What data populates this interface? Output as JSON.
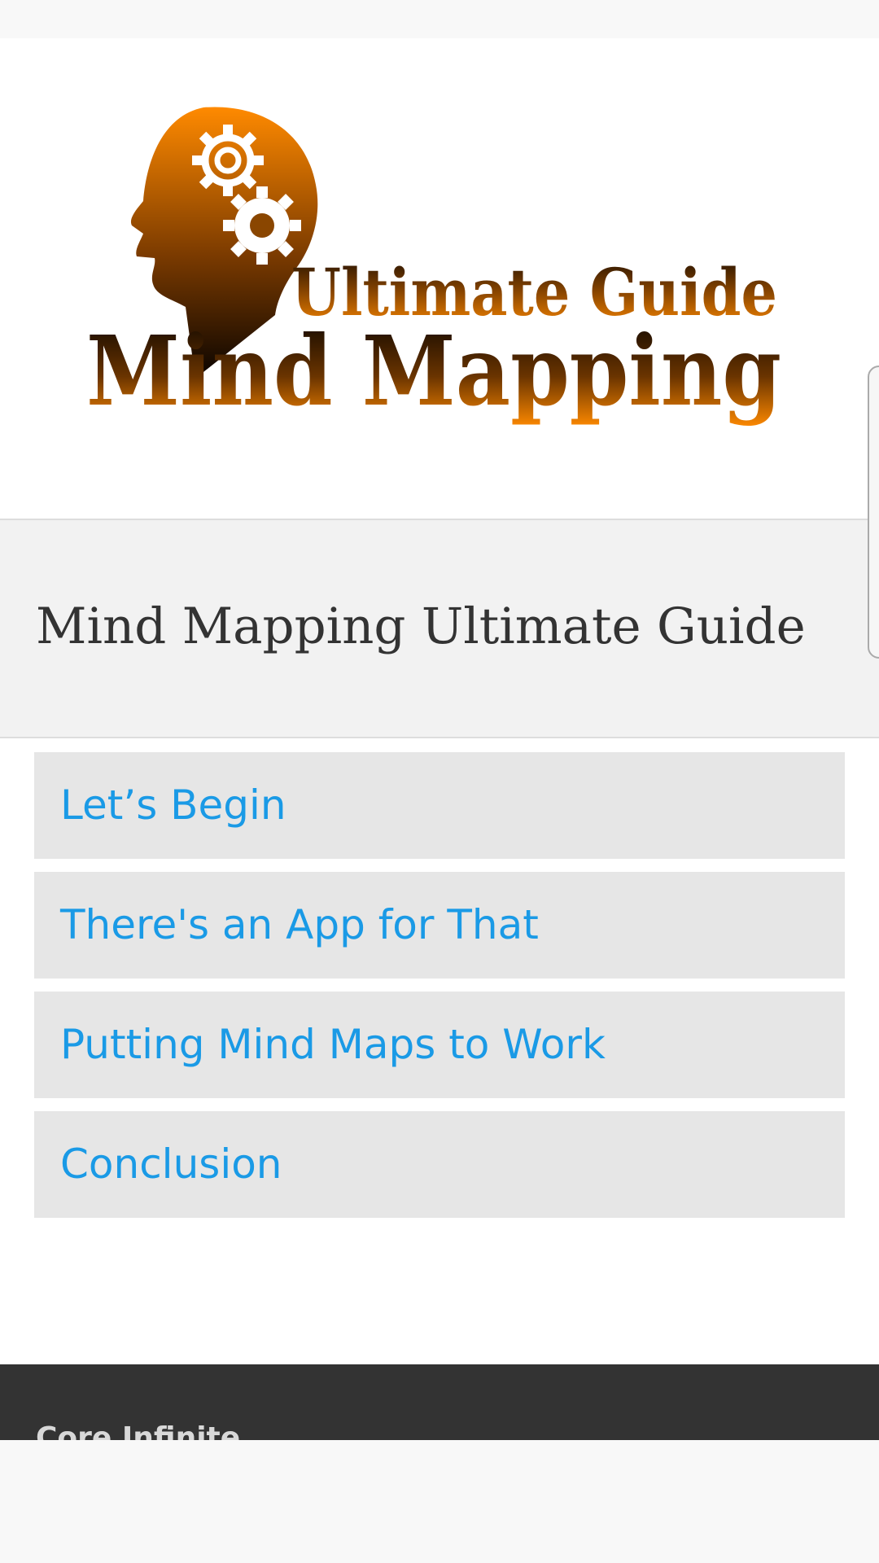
{
  "logo": {
    "line1": "Ultimate Guide",
    "line2": "Mind Mapping",
    "icon": "head-with-gears-icon",
    "colors": {
      "orange": "#ff8a00",
      "dark": "#1a0c00"
    }
  },
  "header": {
    "title": "Mind Mapping Ultimate Guide"
  },
  "menu": {
    "items": [
      {
        "label": "Let’s Begin"
      },
      {
        "label": "There's an App for That"
      },
      {
        "label": "Putting Mind Maps to Work"
      },
      {
        "label": "Conclusion"
      }
    ],
    "link_color": "#1a9ae6"
  },
  "footer": {
    "text": "Core Infinite"
  }
}
